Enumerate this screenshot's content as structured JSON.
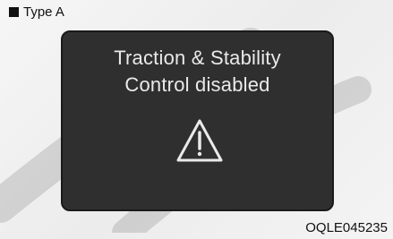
{
  "type_label": "Type A",
  "display": {
    "line1": "Traction & Stability",
    "line2": "Control disabled",
    "icon": "warning-triangle-icon"
  },
  "code": "OQLE045235",
  "colors": {
    "screen": "#2f2f2f",
    "text": "#eaeaea",
    "background": "#f1f1f1"
  }
}
